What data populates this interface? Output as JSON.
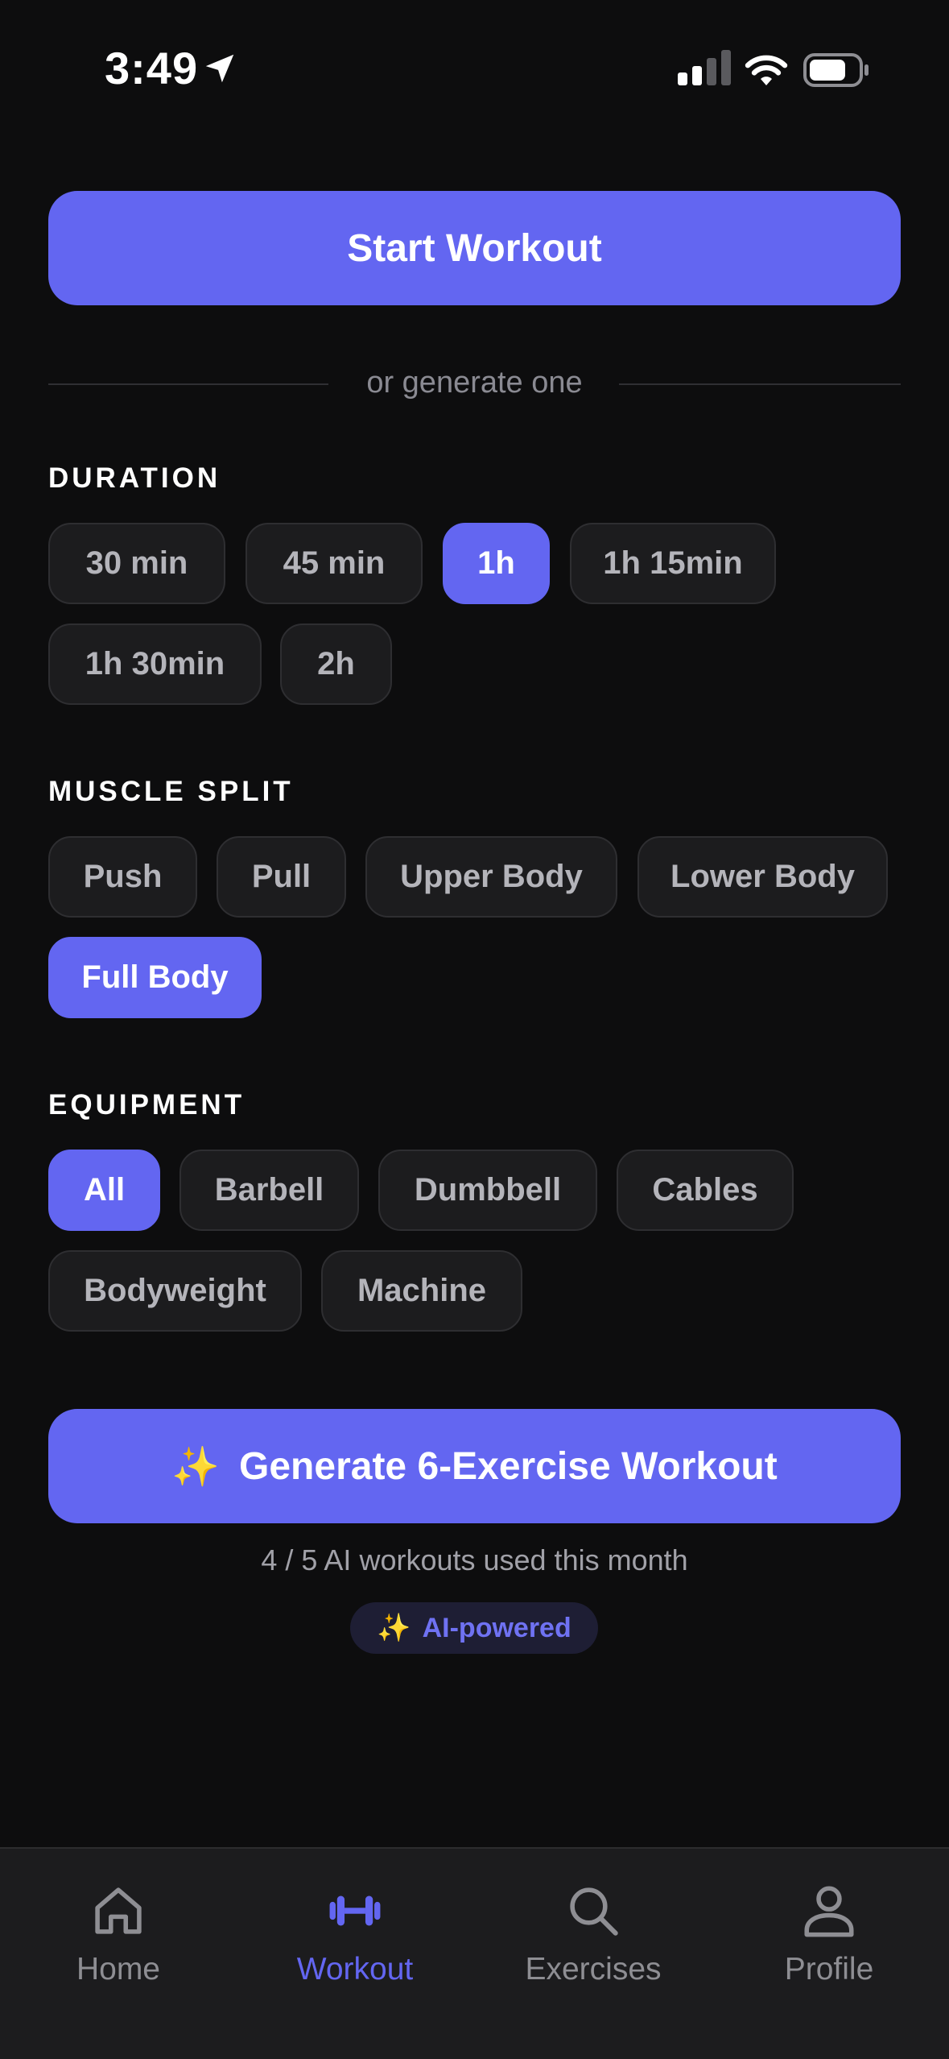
{
  "status_bar": {
    "time": "3:49"
  },
  "primary_action": {
    "label": "Start Workout"
  },
  "divider": {
    "text": "or generate one"
  },
  "duration": {
    "title": "DURATION",
    "options": [
      "30 min",
      "45 min",
      "1h",
      "1h 15min",
      "1h 30min",
      "2h"
    ],
    "selected": "1h"
  },
  "muscle_split": {
    "title": "MUSCLE SPLIT",
    "options": [
      "Push",
      "Pull",
      "Upper Body",
      "Lower Body",
      "Full Body"
    ],
    "selected": "Full Body"
  },
  "equipment": {
    "title": "EQUIPMENT",
    "options": [
      "All",
      "Barbell",
      "Dumbbell",
      "Cables",
      "Bodyweight",
      "Machine"
    ],
    "selected": "All"
  },
  "generate": {
    "icon": "sparkles-icon",
    "label": "Generate 6-Exercise Workout",
    "usage": "4 / 5 AI workouts used this month",
    "badge_label": "AI-powered"
  },
  "tab_bar": {
    "items": [
      {
        "label": "Home",
        "icon": "home-icon"
      },
      {
        "label": "Workout",
        "icon": "dumbbell-icon"
      },
      {
        "label": "Exercises",
        "icon": "search-icon"
      },
      {
        "label": "Profile",
        "icon": "person-icon"
      }
    ],
    "active": "Workout"
  },
  "colors": {
    "accent": "#6366f1",
    "background": "#0d0d0e",
    "chip_background": "#1c1c1e",
    "muted_text": "#8e8e93"
  }
}
